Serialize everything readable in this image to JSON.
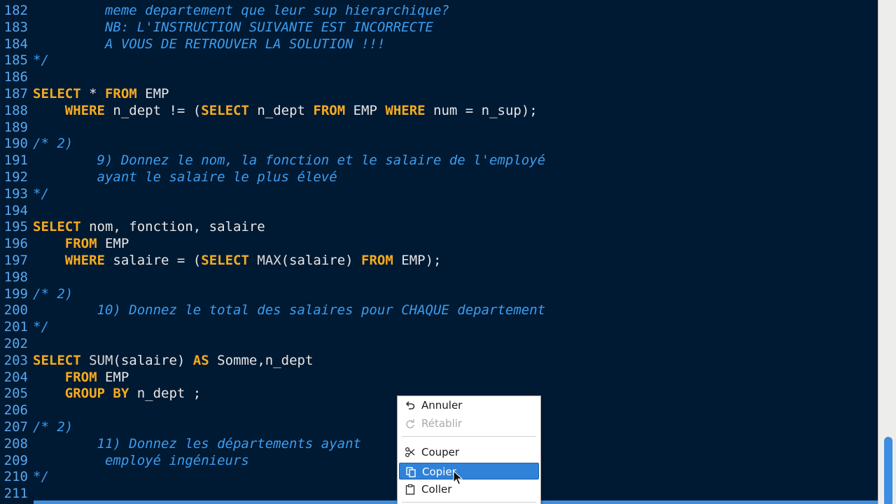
{
  "editor": {
    "lines": [
      {
        "num": "182",
        "tokens": [
          {
            "t": "         meme departement que leur sup hierarchique?",
            "c": "cm"
          }
        ]
      },
      {
        "num": "183",
        "tokens": [
          {
            "t": "         NB: L'INSTRUCTION SUIVANTE EST INCORRECTE",
            "c": "cm"
          }
        ]
      },
      {
        "num": "184",
        "tokens": [
          {
            "t": "         A VOUS DE RETROUVER LA SOLUTION !!!",
            "c": "cm"
          }
        ]
      },
      {
        "num": "185",
        "tokens": [
          {
            "t": "*/",
            "c": "cm"
          }
        ]
      },
      {
        "num": "186",
        "tokens": []
      },
      {
        "num": "187",
        "tokens": [
          {
            "t": "SELECT",
            "c": "kw"
          },
          {
            "t": " * ",
            "c": "tx"
          },
          {
            "t": "FROM",
            "c": "kw"
          },
          {
            "t": " EMP",
            "c": "tx"
          }
        ]
      },
      {
        "num": "188",
        "tokens": [
          {
            "t": "    ",
            "c": "tx"
          },
          {
            "t": "WHERE",
            "c": "kw"
          },
          {
            "t": " n_dept != (",
            "c": "tx"
          },
          {
            "t": "SELECT",
            "c": "kw"
          },
          {
            "t": " n_dept ",
            "c": "tx"
          },
          {
            "t": "FROM",
            "c": "kw"
          },
          {
            "t": " EMP ",
            "c": "tx"
          },
          {
            "t": "WHERE",
            "c": "kw"
          },
          {
            "t": " num = n_sup);",
            "c": "tx"
          }
        ]
      },
      {
        "num": "189",
        "tokens": []
      },
      {
        "num": "190",
        "tokens": [
          {
            "t": "/* 2)",
            "c": "cm"
          }
        ]
      },
      {
        "num": "191",
        "tokens": [
          {
            "t": "        9) Donnez le nom, la fonction et le salaire de l'employé",
            "c": "cm"
          }
        ]
      },
      {
        "num": "192",
        "tokens": [
          {
            "t": "        ayant le salaire le plus élevé",
            "c": "cm"
          }
        ]
      },
      {
        "num": "193",
        "tokens": [
          {
            "t": "*/",
            "c": "cm"
          }
        ]
      },
      {
        "num": "194",
        "tokens": []
      },
      {
        "num": "195",
        "tokens": [
          {
            "t": "SELECT",
            "c": "kw"
          },
          {
            "t": " nom, fonction, salaire",
            "c": "tx"
          }
        ]
      },
      {
        "num": "196",
        "tokens": [
          {
            "t": "    ",
            "c": "tx"
          },
          {
            "t": "FROM",
            "c": "kw"
          },
          {
            "t": " EMP",
            "c": "tx"
          }
        ]
      },
      {
        "num": "197",
        "tokens": [
          {
            "t": "    ",
            "c": "tx"
          },
          {
            "t": "WHERE",
            "c": "kw"
          },
          {
            "t": " salaire = (",
            "c": "tx"
          },
          {
            "t": "SELECT",
            "c": "kw"
          },
          {
            "t": " MAX",
            "c": "fn"
          },
          {
            "t": "(salaire) ",
            "c": "tx"
          },
          {
            "t": "FROM",
            "c": "kw"
          },
          {
            "t": " EMP);",
            "c": "tx"
          }
        ]
      },
      {
        "num": "198",
        "tokens": []
      },
      {
        "num": "199",
        "tokens": [
          {
            "t": "/* 2)",
            "c": "cm"
          }
        ]
      },
      {
        "num": "200",
        "tokens": [
          {
            "t": "        10) Donnez le total des salaires pour CHAQUE departement",
            "c": "cm"
          }
        ]
      },
      {
        "num": "201",
        "tokens": [
          {
            "t": "*/",
            "c": "cm"
          }
        ]
      },
      {
        "num": "202",
        "tokens": []
      },
      {
        "num": "203",
        "tokens": [
          {
            "t": "SELECT",
            "c": "kw"
          },
          {
            "t": " SUM",
            "c": "fn"
          },
          {
            "t": "(salaire) ",
            "c": "tx"
          },
          {
            "t": "AS",
            "c": "kw"
          },
          {
            "t": " Somme,n_dept",
            "c": "tx"
          }
        ]
      },
      {
        "num": "204",
        "tokens": [
          {
            "t": "    ",
            "c": "tx"
          },
          {
            "t": "FROM",
            "c": "kw"
          },
          {
            "t": " EMP",
            "c": "tx"
          }
        ]
      },
      {
        "num": "205",
        "tokens": [
          {
            "t": "    ",
            "c": "tx"
          },
          {
            "t": "GROUP BY",
            "c": "kw"
          },
          {
            "t": " n_dept ;",
            "c": "tx"
          }
        ]
      },
      {
        "num": "206",
        "tokens": []
      },
      {
        "num": "207",
        "tokens": [
          {
            "t": "/* 2)",
            "c": "cm"
          }
        ]
      },
      {
        "num": "208",
        "tokens": [
          {
            "t": "        11) Donnez les départements ayant",
            "c": "cm"
          }
        ]
      },
      {
        "num": "209",
        "tokens": [
          {
            "t": "         employé ingénieurs",
            "c": "cm"
          }
        ]
      },
      {
        "num": "210",
        "tokens": [
          {
            "t": "*/",
            "c": "cm"
          }
        ]
      },
      {
        "num": "211",
        "tokens": []
      }
    ]
  },
  "context_menu": {
    "items": [
      {
        "label": "Annuler",
        "icon": "undo-icon",
        "state": "normal"
      },
      {
        "label": "Rétablir",
        "icon": "redo-icon",
        "state": "disabled"
      },
      {
        "label": "Couper",
        "icon": "scissors-icon",
        "state": "normal"
      },
      {
        "label": "Copier",
        "icon": "copy-icon",
        "state": "active"
      },
      {
        "label": "Coller",
        "icon": "paste-icon",
        "state": "normal"
      }
    ]
  },
  "colors": {
    "background": "#001a33",
    "keyword": "#f6ab1f",
    "comment": "#3d9df0",
    "line_number": "#5aa7ef",
    "selection": "#2f82d8"
  }
}
